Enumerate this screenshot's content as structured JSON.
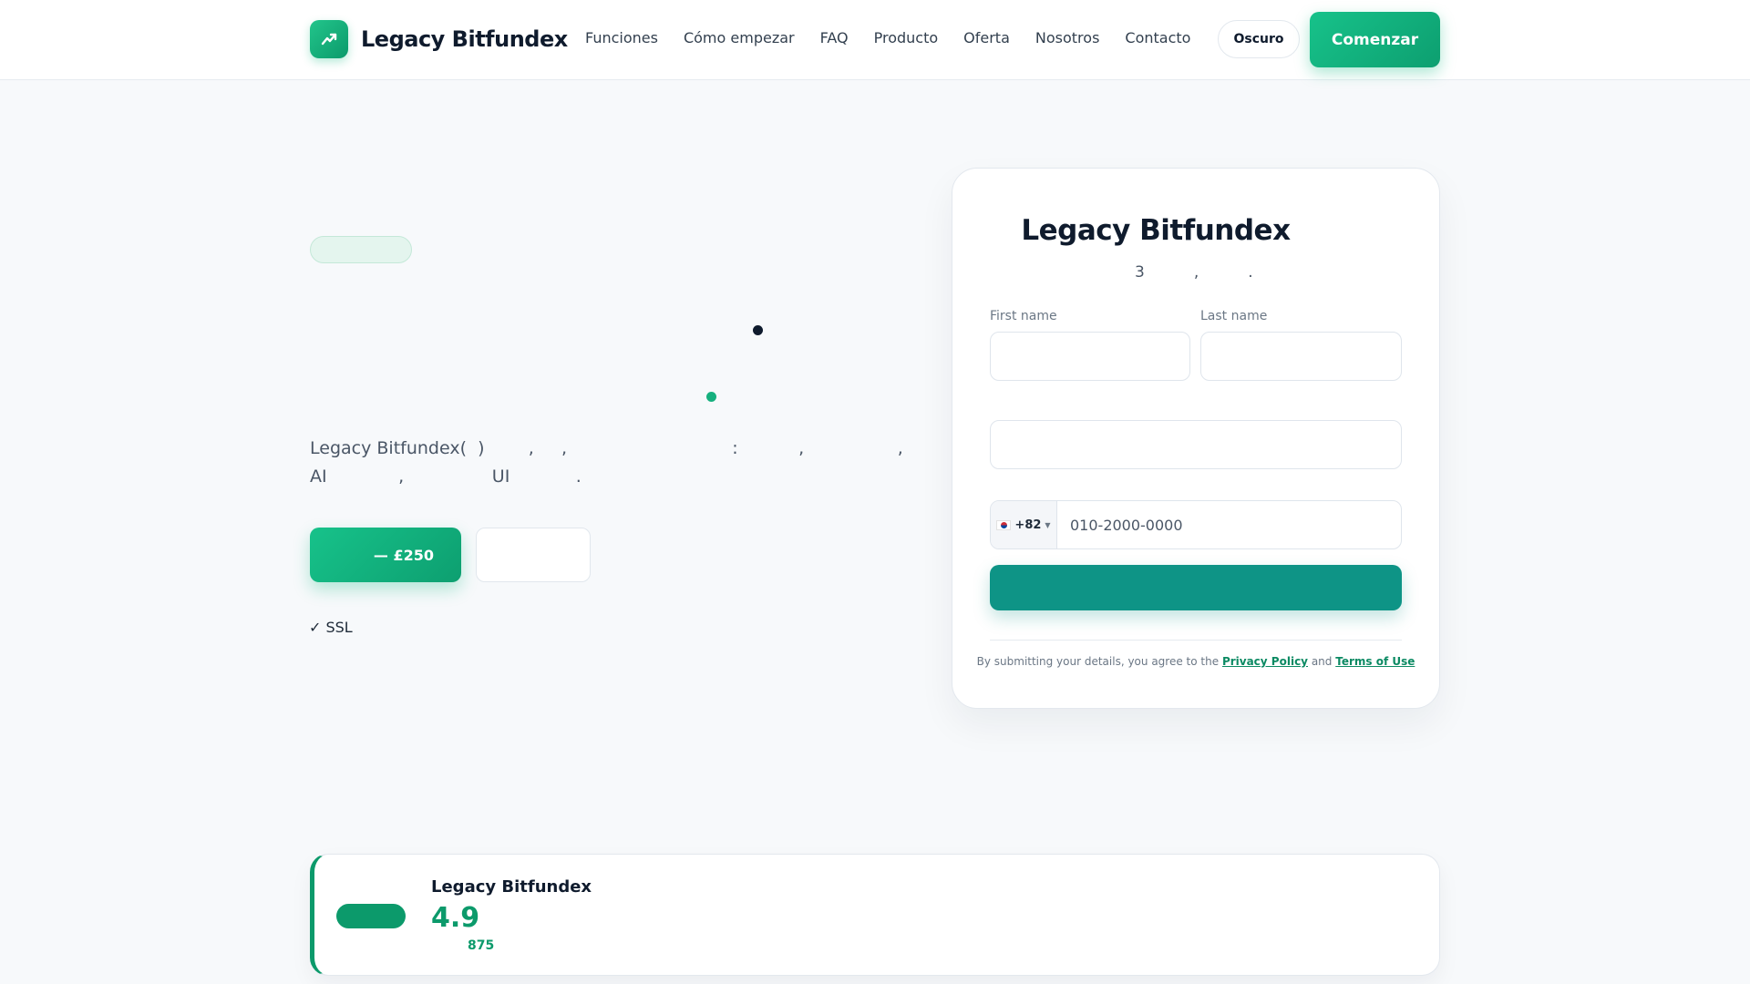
{
  "header": {
    "brand": "Legacy Bitfundex",
    "nav": [
      "Funciones",
      "Cómo empezar",
      "FAQ",
      "Producto",
      "Oferta",
      "Nosotros",
      "Contacto"
    ],
    "theme_toggle": "Oscuro",
    "cta": "Comenzar",
    "logo_icon": "trend-up-icon"
  },
  "hero": {
    "description_lines": [
      "Legacy Bitfundex(  )        ,     ,                              :           ,                 ,",
      "AI             ,                UI            ."
    ],
    "primary_button": "— £250",
    "ssl_note": "✓ SSL"
  },
  "form": {
    "title": "Legacy Bitfundex",
    "subtitle": "3          ,          .",
    "first_name_label": "First name",
    "last_name_label": "Last name",
    "country_code": "+82",
    "phone_placeholder": "010-2000-0000",
    "legal_prefix": "By submitting your details, you agree to the",
    "privacy_link": "Privacy Policy",
    "legal_and": "and",
    "terms_link": "Terms of Use"
  },
  "rating": {
    "brand": "Legacy Bitfundex",
    "score": "4.9",
    "count": "875"
  },
  "colors": {
    "accent": "#0c9a6b",
    "submit": "#0e9486",
    "text_dark": "#0f1b2d"
  }
}
